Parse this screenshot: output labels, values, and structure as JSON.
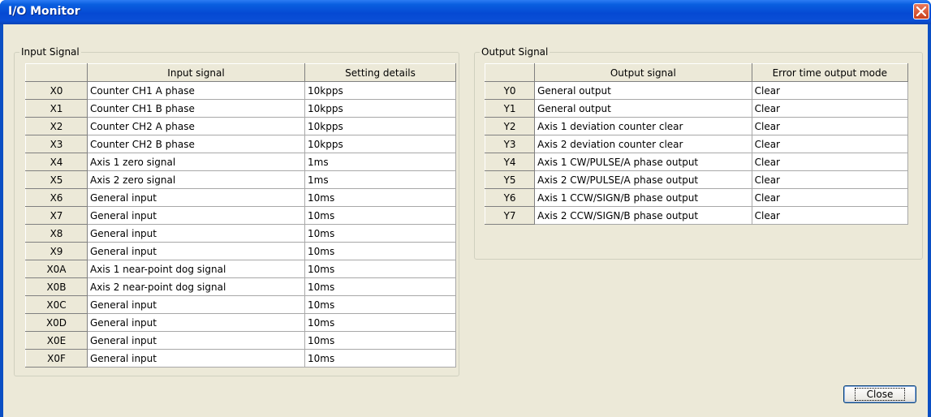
{
  "window": {
    "title": "I/O Monitor"
  },
  "input_group": {
    "label": "Input Signal",
    "headers": [
      "",
      "Input signal",
      "Setting details"
    ],
    "rows": [
      {
        "id": "X0",
        "signal": "Counter CH1 A phase",
        "detail": "10kpps"
      },
      {
        "id": "X1",
        "signal": "Counter CH1 B phase",
        "detail": "10kpps"
      },
      {
        "id": "X2",
        "signal": "Counter CH2 A phase",
        "detail": "10kpps"
      },
      {
        "id": "X3",
        "signal": "Counter CH2 B phase",
        "detail": "10kpps"
      },
      {
        "id": "X4",
        "signal": "Axis 1 zero signal",
        "detail": "1ms"
      },
      {
        "id": "X5",
        "signal": "Axis 2 zero signal",
        "detail": "1ms"
      },
      {
        "id": "X6",
        "signal": "General input",
        "detail": "10ms"
      },
      {
        "id": "X7",
        "signal": "General input",
        "detail": "10ms"
      },
      {
        "id": "X8",
        "signal": "General input",
        "detail": "10ms"
      },
      {
        "id": "X9",
        "signal": "General input",
        "detail": "10ms"
      },
      {
        "id": "X0A",
        "signal": "Axis 1 near-point dog signal",
        "detail": "10ms"
      },
      {
        "id": "X0B",
        "signal": "Axis 2 near-point dog signal",
        "detail": "10ms"
      },
      {
        "id": "X0C",
        "signal": "General input",
        "detail": "10ms"
      },
      {
        "id": "X0D",
        "signal": "General input",
        "detail": "10ms"
      },
      {
        "id": "X0E",
        "signal": "General input",
        "detail": "10ms"
      },
      {
        "id": "X0F",
        "signal": "General input",
        "detail": "10ms"
      }
    ]
  },
  "output_group": {
    "label": "Output Signal",
    "headers": [
      "",
      "Output signal",
      "Error time output mode"
    ],
    "rows": [
      {
        "id": "Y0",
        "signal": "General output",
        "mode": "Clear"
      },
      {
        "id": "Y1",
        "signal": "General output",
        "mode": "Clear"
      },
      {
        "id": "Y2",
        "signal": "Axis 1 deviation counter clear",
        "mode": "Clear"
      },
      {
        "id": "Y3",
        "signal": "Axis 2 deviation counter clear",
        "mode": "Clear"
      },
      {
        "id": "Y4",
        "signal": "Axis 1 CW/PULSE/A phase output",
        "mode": "Clear"
      },
      {
        "id": "Y5",
        "signal": "Axis 2 CW/PULSE/A phase output",
        "mode": "Clear"
      },
      {
        "id": "Y6",
        "signal": "Axis 1 CCW/SIGN/B phase output",
        "mode": "Clear"
      },
      {
        "id": "Y7",
        "signal": "Axis 2 CCW/SIGN/B phase output",
        "mode": "Clear"
      }
    ]
  },
  "buttons": {
    "close_label": "Close"
  },
  "icons": {
    "title_close": "close-icon"
  }
}
